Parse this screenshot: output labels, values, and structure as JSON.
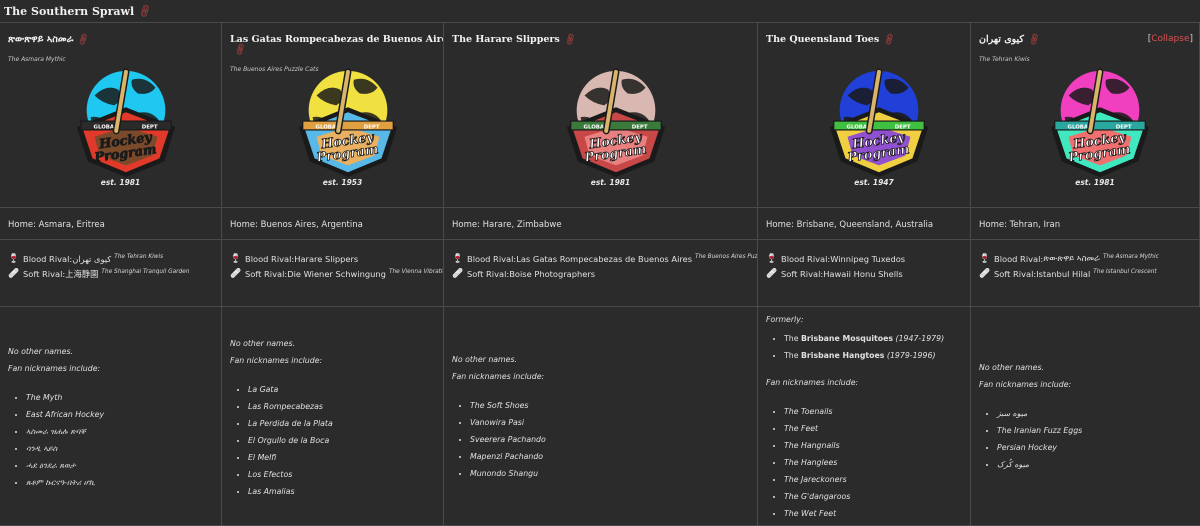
{
  "section": {
    "title": "The Southern Sprawl"
  },
  "collapse_label": "Collapse",
  "teams": [
    {
      "name": "ጽውጽዋይ ኣስመራ",
      "tagline": "The Asmara Mythic",
      "est": "est. 1981",
      "logo_colors": {
        "globe": "#1ec8f0",
        "badge": "#e23a2a",
        "inner": "#7a4a2a",
        "text": "#1a1a1a",
        "band": "#2a2a2a"
      },
      "home": "Home: Asmara, Eritrea",
      "blood_rival": {
        "label": "Blood Rival: ",
        "name": "کیوی تهران",
        "sub": "The Tehran Kiwis"
      },
      "soft_rival": {
        "label": "Soft Rival: ",
        "name": "上海静園",
        "sub": "The Shanghai Tranquil Garden"
      },
      "names_intro": "No other names.",
      "fan_intro": "Fan nicknames include:",
      "formerly": null,
      "nicknames": [
        "The Myth",
        "East African Hockey",
        "ኣስመራ ዝሐሉ ጽባቐ",
        "ሳንዲ ኣይስ",
        "ሓደ ዕንደራ ጸወታ",
        "ጸቶም ኩርናዓ-በትሪ ሆኪ"
      ]
    },
    {
      "name": "Las Gatas Rompecabezas de Buenos Aires",
      "tagline": "The Buenos Aires Puzzle Cats",
      "est": "est. 1953",
      "logo_colors": {
        "globe": "#f0e040",
        "badge": "#58b8e8",
        "inner": "#e8b060",
        "text": "#ffffff",
        "band": "#e0a040"
      },
      "home": "Home: Buenos Aires, Argentina",
      "blood_rival": {
        "label": "Blood Rival: ",
        "name": "Harare Slippers",
        "sub": ""
      },
      "soft_rival": {
        "label": "Soft Rival: ",
        "name": "Die Wiener Schwingung",
        "sub": "The Vienna Vibration"
      },
      "names_intro": "No other names.",
      "fan_intro": "Fan nicknames include:",
      "formerly": null,
      "nicknames": [
        "La Gata",
        "Las Rompecabezas",
        "La Perdida de la Plata",
        "El Orgullo de la Boca",
        "El Melfi",
        "Los Efectos",
        "Las Amalias"
      ]
    },
    {
      "name": "The Harare Slippers",
      "tagline": "",
      "est": "est. 1981",
      "logo_colors": {
        "globe": "#d8b8b0",
        "badge": "#c84848",
        "inner": "#e88080",
        "text": "#ffffff",
        "band": "#3a7a3a"
      },
      "home": "Home: Harare, Zimbabwe",
      "blood_rival": {
        "label": "Blood Rival: ",
        "name": "Las Gatas Rompecabezas de Buenos Aires",
        "sub": "The Buenos Aires Puzzle Cats"
      },
      "soft_rival": {
        "label": "Soft Rival: ",
        "name": "Boise Photographers",
        "sub": ""
      },
      "names_intro": "No other names.",
      "fan_intro": "Fan nicknames include:",
      "formerly": null,
      "nicknames": [
        "The Soft Shoes",
        "Vanowira Pasi",
        "Sveerera Pachando",
        "Mapenzi Pachando",
        "Munondo Shangu"
      ]
    },
    {
      "name": "The Queensland Toes",
      "tagline": "",
      "est": "est. 1947",
      "logo_colors": {
        "globe": "#2040d8",
        "badge": "#f0d040",
        "inner": "#9050d0",
        "text": "#ffffff",
        "band": "#40c040"
      },
      "home": "Home: Brisbane, Queensland, Australia",
      "blood_rival": {
        "label": "Blood Rival: ",
        "name": "Winnipeg Tuxedos",
        "sub": ""
      },
      "soft_rival": {
        "label": "Soft Rival: ",
        "name": "Hawaii Honu Shells",
        "sub": ""
      },
      "names_intro": "",
      "fan_intro": "Fan nicknames include:",
      "formerly": {
        "label": "Formerly:",
        "items": [
          {
            "prefix": "The ",
            "bold": "Brisbane Mosquitoes",
            "years": " (1947-1979)"
          },
          {
            "prefix": "The ",
            "bold": "Brisbane Hangtoes",
            "years": " (1979-1996)"
          }
        ]
      },
      "nicknames": [
        "The Toenails",
        "The Feet",
        "The Hangnails",
        "The Hanglees",
        "The Jareckoners",
        "The G'dangaroos",
        "The Wet Feet"
      ]
    },
    {
      "name": "کیوی تهران",
      "tagline": "The Tehran Kiwis",
      "est": "est. 1981",
      "logo_colors": {
        "globe": "#f040c0",
        "badge": "#40e8c0",
        "inner": "#f07070",
        "text": "#ffffff",
        "band": "#2aa8a0"
      },
      "home": "Home: Tehran, Iran",
      "blood_rival": {
        "label": "Blood Rival: ",
        "name": "ጽውጽዋይ ኣስመራ",
        "sub": "The Asmara Mythic"
      },
      "soft_rival": {
        "label": "Soft Rival: ",
        "name": "Istanbul Hilal",
        "sub": "The Istanbul Crescent"
      },
      "names_intro": "No other names.",
      "fan_intro": "Fan nicknames include:",
      "formerly": null,
      "nicknames": [
        "میوه سبز",
        "The Iranian Fuzz Eggs",
        "Persian Hockey",
        "میوه کُرک"
      ]
    }
  ],
  "logo_text": {
    "global": "GLOBAL",
    "dept": "DEPT",
    "line1": "Hockey",
    "line2": "Program"
  }
}
